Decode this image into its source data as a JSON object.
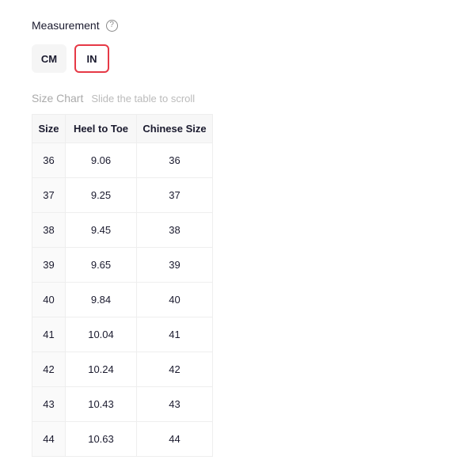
{
  "measurement": {
    "label": "Measurement",
    "help_glyph": "?"
  },
  "units": {
    "cm": "CM",
    "in": "IN"
  },
  "chart": {
    "title": "Size Chart",
    "hint": "Slide the table to scroll",
    "headers": {
      "size": "Size",
      "heel_to_toe": "Heel to Toe",
      "chinese_size": "Chinese Size"
    },
    "rows": [
      {
        "size": "36",
        "heel_to_toe": "9.06",
        "chinese_size": "36"
      },
      {
        "size": "37",
        "heel_to_toe": "9.25",
        "chinese_size": "37"
      },
      {
        "size": "38",
        "heel_to_toe": "9.45",
        "chinese_size": "38"
      },
      {
        "size": "39",
        "heel_to_toe": "9.65",
        "chinese_size": "39"
      },
      {
        "size": "40",
        "heel_to_toe": "9.84",
        "chinese_size": "40"
      },
      {
        "size": "41",
        "heel_to_toe": "10.04",
        "chinese_size": "41"
      },
      {
        "size": "42",
        "heel_to_toe": "10.24",
        "chinese_size": "42"
      },
      {
        "size": "43",
        "heel_to_toe": "10.43",
        "chinese_size": "43"
      },
      {
        "size": "44",
        "heel_to_toe": "10.63",
        "chinese_size": "44"
      }
    ]
  }
}
